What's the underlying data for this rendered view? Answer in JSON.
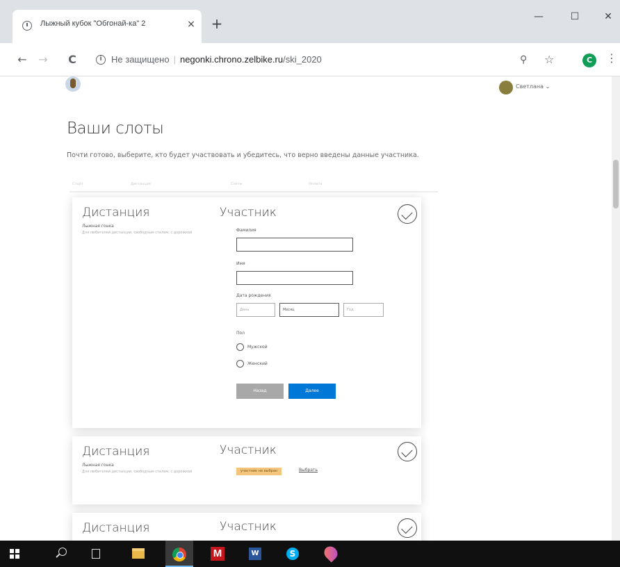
{
  "browser": {
    "tab_title": "Лыжный кубок \"Обгонай-ка\" 2",
    "tab_close": "×",
    "new_tab": "+",
    "window_controls": {
      "minimize": "—",
      "maximize": "☐",
      "close": "✕"
    },
    "nav": {
      "back": "←",
      "forward": "→",
      "reload": "C"
    },
    "url": {
      "security": "Не защищено",
      "host": "negonki.chrono.zelbike.ru",
      "path": "/ski_2020"
    },
    "profile_letter": "C",
    "icons": [
      "history-icon",
      "back-icon",
      "forward-icon",
      "reload-icon",
      "info-icon",
      "zoom-icon",
      "star-icon",
      "menu-icon"
    ]
  },
  "header": {
    "user_name": "Светлана ⌄"
  },
  "main": {
    "title": "Ваши слоты",
    "subtitle": "Почти готово, выберите, кто будет участвовать и убедитесь, что верно введены данные участника.",
    "steps": [
      "Старт",
      "Дистанция",
      "Слоты",
      "Оплата"
    ]
  },
  "cards": [
    {
      "distance_title": "Дистанция",
      "distance_name": "Лыжная гонка",
      "distance_desc": "Для любителей дистанции, свободным стилем, с дорожкой",
      "participant_title": "Участник",
      "form": {
        "lastname_label": "Фамилия",
        "lastname_value": "",
        "firstname_label": "Имя",
        "firstname_value": "",
        "birthdate_label": "Дата рождения",
        "day_placeholder": "День",
        "month_value": "Месяц",
        "year_placeholder": "Год",
        "gender_label": "Пол",
        "gender_options": [
          "Мужской",
          "Женский"
        ],
        "back_label": "Назад",
        "next_label": "Далее"
      }
    },
    {
      "distance_title": "Дистанция",
      "distance_name": "Лыжная гонка",
      "distance_desc": "Для любителей дистанции, свободным стилем, с дорожкой",
      "participant_title": "Участник",
      "badge": "участник не выбран",
      "choose_link": "Выбрать"
    },
    {
      "distance_title": "Дистанция",
      "participant_title": "Участник"
    }
  ],
  "taskbar": {
    "items": [
      "windows-start",
      "search",
      "task-view",
      "file-explorer",
      "chrome",
      "mail-m",
      "word",
      "skype",
      "maps"
    ],
    "active": "chrome"
  },
  "colors": {
    "accent_blue": "#0078d7",
    "back_gray": "#a8a8a8",
    "badge_orange": "#f5c57c"
  }
}
